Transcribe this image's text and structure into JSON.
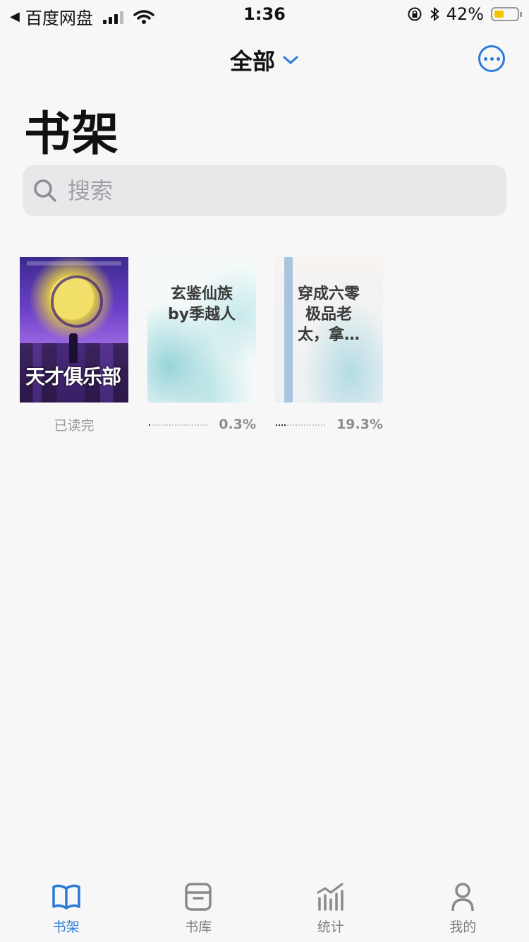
{
  "status_bar": {
    "back_app": "百度网盘",
    "time": "1:36",
    "battery_percent": "42%",
    "battery_level": 0.42,
    "battery_color": "#f5c400"
  },
  "nav": {
    "filter_title": "全部",
    "filter_icon": "chevron-down-icon",
    "more_icon": "ellipsis-circle-icon",
    "accent_color": "#2a7ad8"
  },
  "page_title": "书架",
  "search": {
    "placeholder": "搜索",
    "icon": "search-icon"
  },
  "books": [
    {
      "cover_logo": "天才俱乐部",
      "status": "已读完"
    },
    {
      "cover_title": "玄鉴仙族\nby季越人",
      "progress": "0.3%",
      "progress_value": 0.003
    },
    {
      "cover_title": "穿成六零\n极品老\n太，拿…",
      "progress": "19.3%",
      "progress_value": 0.193
    }
  ],
  "tabs": [
    {
      "label": "书架",
      "icon": "book-open-icon",
      "active": true
    },
    {
      "label": "书库",
      "icon": "archive-box-icon",
      "active": false
    },
    {
      "label": "统计",
      "icon": "bar-chart-icon",
      "active": false
    },
    {
      "label": "我的",
      "icon": "person-icon",
      "active": false
    }
  ]
}
